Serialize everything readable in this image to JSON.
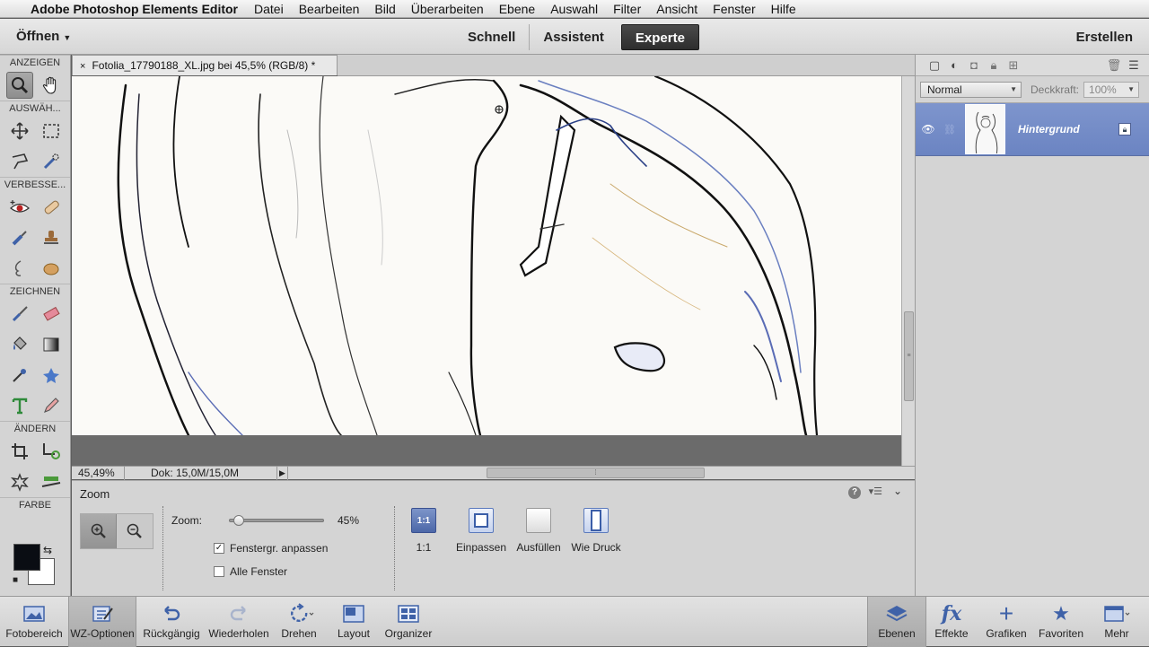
{
  "menubar": {
    "app": "Adobe Photoshop Elements Editor",
    "items": [
      "Datei",
      "Bearbeiten",
      "Bild",
      "Überarbeiten",
      "Ebene",
      "Auswahl",
      "Filter",
      "Ansicht",
      "Fenster",
      "Hilfe"
    ]
  },
  "topbar": {
    "open_label": "Öffnen",
    "modes": [
      "Schnell",
      "Assistent",
      "Experte"
    ],
    "active_mode": "Experte",
    "create_label": "Erstellen"
  },
  "toolbox": {
    "sections": {
      "view": "ANZEIGEN",
      "select": "AUSWÄH...",
      "enhance": "VERBESSE...",
      "draw": "ZEICHNEN",
      "modify": "ÄNDERN",
      "color": "FARBE"
    },
    "colors": {
      "foreground": "#0a0d13",
      "background": "#ffffff"
    }
  },
  "document": {
    "tab_title": "Fotolia_17790188_XL.jpg bei 45,5% (RGB/8) *",
    "close_glyph": "×"
  },
  "statusbar": {
    "zoom": "45,49%",
    "doc_size": "Dok: 15,0M/15,0M"
  },
  "tool_options": {
    "title": "Zoom",
    "zoom_label": "Zoom:",
    "zoom_value": "45%",
    "zoom_fraction": 0.045,
    "fit_window_label": "Fenstergr. anpassen",
    "fit_window_checked": true,
    "all_windows_label": "Alle Fenster",
    "all_windows_checked": false,
    "view_buttons": [
      {
        "icon_text": "1:1",
        "label": "1:1"
      },
      {
        "label": "Einpassen"
      },
      {
        "label": "Ausfüllen"
      },
      {
        "label": "Wie Druck"
      }
    ]
  },
  "layers": {
    "blend_mode": "Normal",
    "opacity_label": "Deckkraft:",
    "opacity_value": "100%",
    "layer_name": "Hintergrund"
  },
  "taskbar": {
    "items": [
      "Fotobereich",
      "WZ-Optionen",
      "Rückgängig",
      "Wiederholen",
      "Drehen",
      "Layout",
      "Organizer",
      "Ebenen",
      "Effekte",
      "Grafiken",
      "Favoriten",
      "Mehr"
    ],
    "accent": "#3f62a8"
  }
}
